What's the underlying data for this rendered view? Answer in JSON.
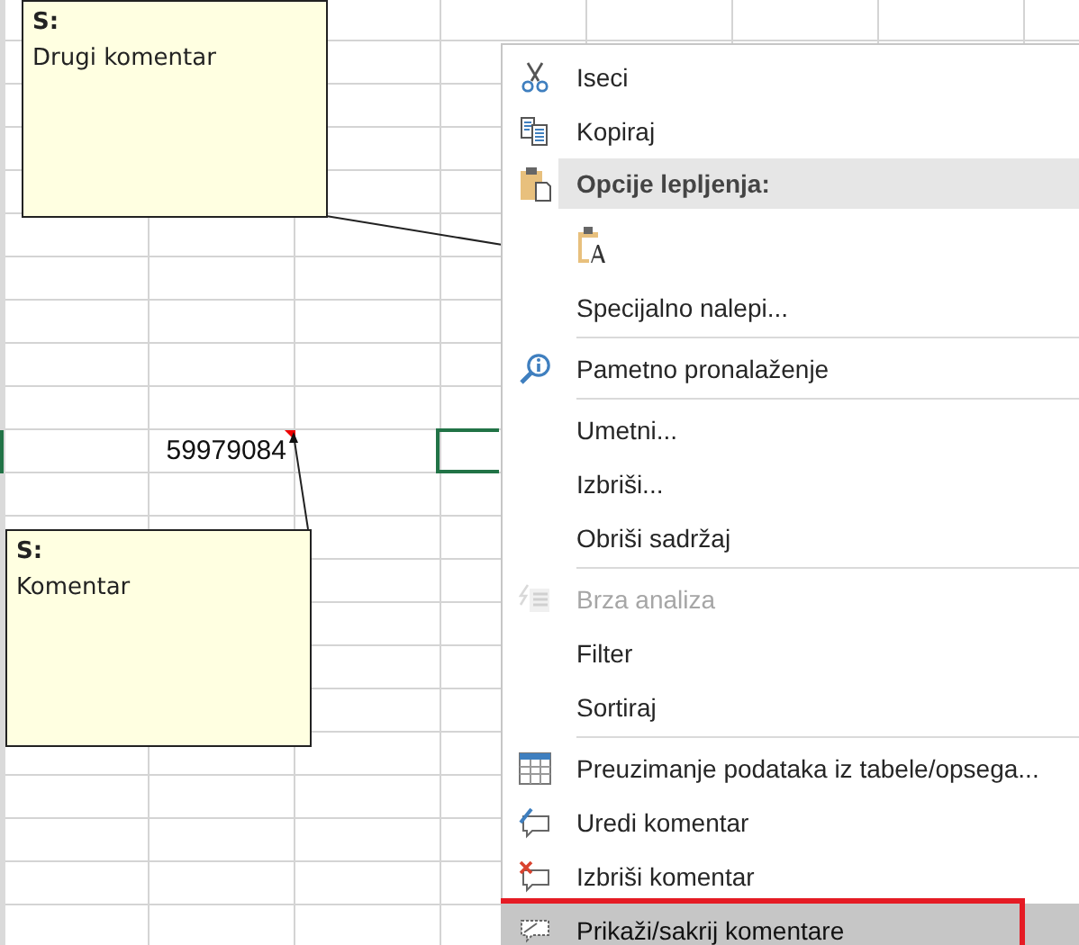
{
  "sheet": {
    "cell": {
      "value": "59979084",
      "has_comment": true
    },
    "selected_cell": true
  },
  "comments": [
    {
      "author": "S:",
      "text": "Drugi komentar"
    },
    {
      "author": "S:",
      "text": "Komentar"
    }
  ],
  "context_menu": {
    "items": [
      {
        "kind": "item",
        "label": "Iseci",
        "disabled": false,
        "selected": false,
        "outlined": false
      },
      {
        "kind": "item",
        "label": "Kopiraj",
        "disabled": false,
        "selected": false,
        "outlined": false
      },
      {
        "kind": "header",
        "label": "Opcije lepljenja:"
      },
      {
        "kind": "paste-option"
      },
      {
        "kind": "item",
        "label": "Specijalno nalepi...",
        "disabled": false,
        "selected": false,
        "outlined": false
      },
      {
        "kind": "separator"
      },
      {
        "kind": "item",
        "label": "Pametno pronalaženje",
        "disabled": false,
        "selected": false,
        "outlined": false
      },
      {
        "kind": "separator"
      },
      {
        "kind": "item",
        "label": "Umetni...",
        "disabled": false,
        "selected": false,
        "outlined": false
      },
      {
        "kind": "item",
        "label": "Izbriši...",
        "disabled": false,
        "selected": false,
        "outlined": false
      },
      {
        "kind": "item",
        "label": "Obriši sadržaj",
        "disabled": false,
        "selected": false,
        "outlined": false
      },
      {
        "kind": "separator"
      },
      {
        "kind": "item",
        "label": "Brza analiza",
        "disabled": true,
        "selected": false,
        "outlined": false
      },
      {
        "kind": "item",
        "label": "Filter",
        "disabled": false,
        "selected": false,
        "outlined": false
      },
      {
        "kind": "item",
        "label": "Sortiraj",
        "disabled": false,
        "selected": false,
        "outlined": false
      },
      {
        "kind": "separator"
      },
      {
        "kind": "item",
        "label": "Preuzimanje podataka iz tabele/opsega...",
        "disabled": false,
        "selected": false,
        "outlined": false
      },
      {
        "kind": "item",
        "label": "Uredi komentar",
        "disabled": false,
        "selected": false,
        "outlined": false
      },
      {
        "kind": "item",
        "label": "Izbriši komentar",
        "disabled": false,
        "selected": false,
        "outlined": false
      },
      {
        "kind": "item",
        "label": "Prikaži/sakrij komentare",
        "disabled": false,
        "selected": true,
        "outlined": true
      }
    ]
  }
}
